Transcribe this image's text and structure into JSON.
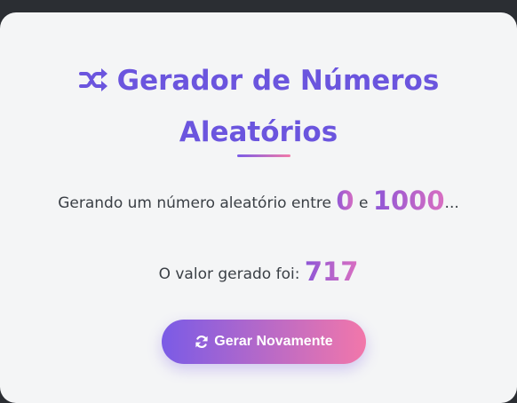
{
  "header": {
    "title_line1": "Gerador de Números",
    "title_line2": "Aleatórios",
    "icon": "shuffle-icon"
  },
  "range": {
    "prefix": "Gerando um número aleatório entre",
    "min": "0",
    "connector": "e",
    "max": "1000",
    "suffix": "..."
  },
  "result": {
    "label": "O valor gerado foi:",
    "value": "717"
  },
  "button": {
    "label": "Gerar Novamente",
    "icon": "sync-icon"
  },
  "colors": {
    "accent": "#6b55de",
    "gradient_start": "#7a5be6",
    "gradient_end": "#f277aa",
    "card_background": "#f4f5f6",
    "page_background": "#2b2e33"
  }
}
